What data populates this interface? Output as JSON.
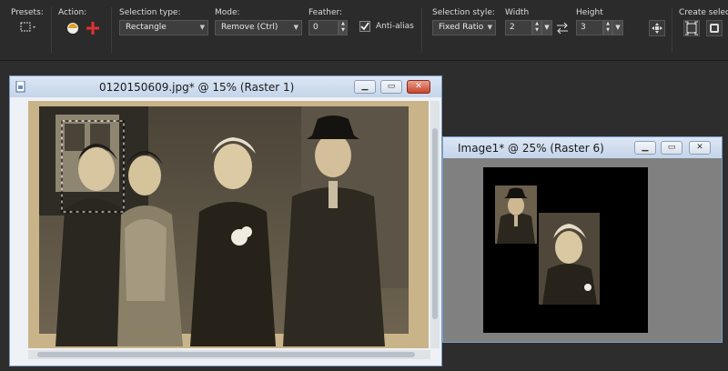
{
  "toolbar": {
    "presets_label": "Presets:",
    "action_label": "Action:",
    "selection_type_label": "Selection type:",
    "selection_type_value": "Rectangle",
    "mode_label": "Mode:",
    "mode_value": "Remove (Ctrl)",
    "feather_label": "Feather:",
    "feather_value": "0",
    "antialias_label": "Anti-alias",
    "antialias_checked": true,
    "selection_style_label": "Selection style:",
    "selection_style_value": "Fixed Ratio",
    "width_label": "Width",
    "width_value": "2",
    "height_label": "Height",
    "height_value": "3",
    "create_selection_label": "Create selectio"
  },
  "window_main": {
    "title": "0120150609.jpg* @  15% (Raster 1)"
  },
  "window_image1": {
    "title": "Image1* @  25% (Raster 6)"
  },
  "colors": {
    "titlebar": "#c9d8ec",
    "photo_sepia": "#b9a27c",
    "canvas_bg": "#000000"
  }
}
